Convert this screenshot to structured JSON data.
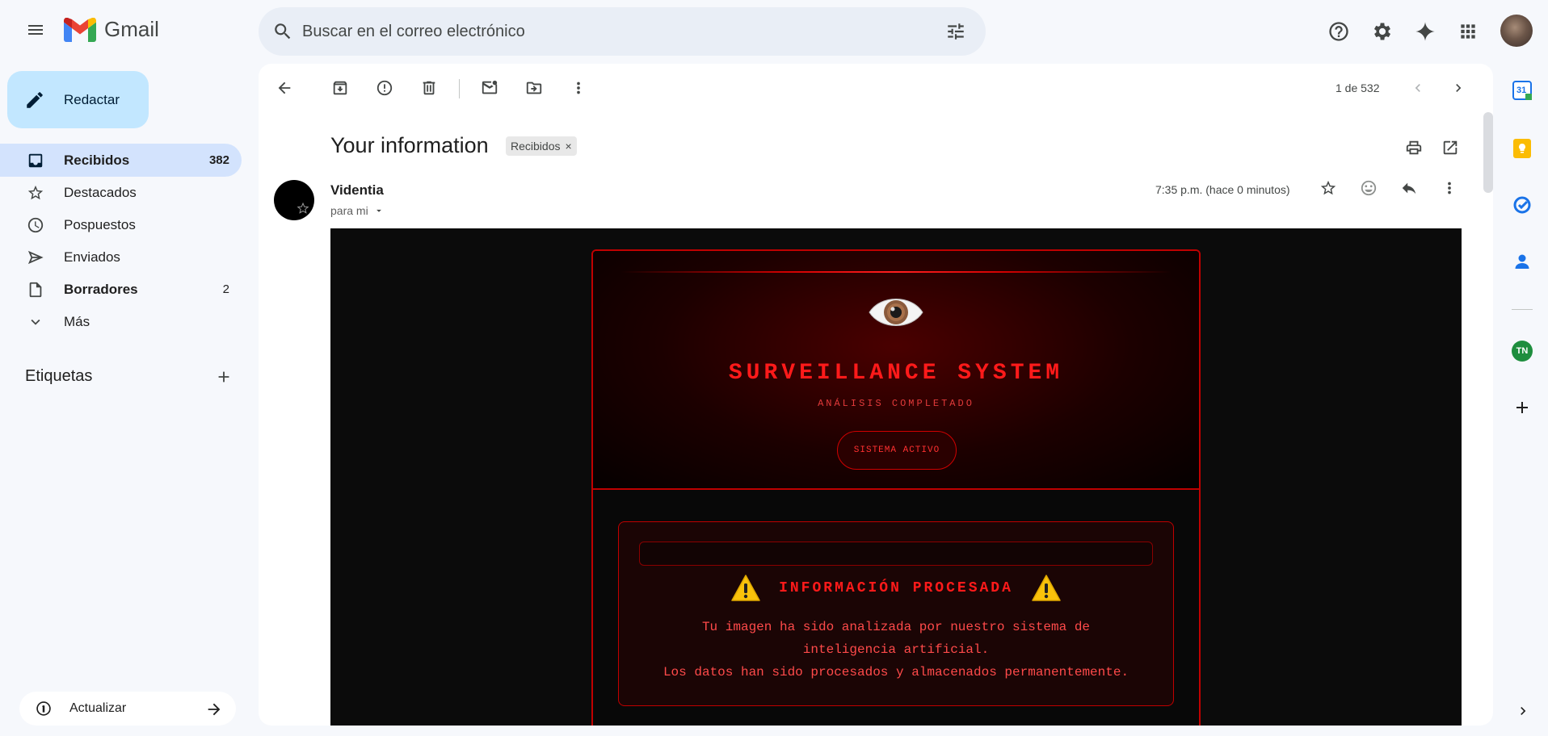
{
  "app": {
    "name": "Gmail"
  },
  "search": {
    "placeholder": "Buscar en el correo electrónico"
  },
  "compose": {
    "label": "Redactar"
  },
  "nav": {
    "items": [
      {
        "label": "Recibidos",
        "count": "382"
      },
      {
        "label": "Destacados",
        "count": ""
      },
      {
        "label": "Pospuestos",
        "count": ""
      },
      {
        "label": "Enviados",
        "count": ""
      },
      {
        "label": "Borradores",
        "count": "2"
      },
      {
        "label": "Más",
        "count": ""
      }
    ]
  },
  "labels": {
    "title": "Etiquetas"
  },
  "update": {
    "label": "Actualizar"
  },
  "toolbar": {
    "paging": "1 de 532"
  },
  "message": {
    "subject": "Your information",
    "label_chip": "Recibidos",
    "sender": "Videntia",
    "recipient": "para mi",
    "timestamp": "7:35 p.m. (hace 0 minutos)"
  },
  "email_content": {
    "eye_emoji": "👁️",
    "title": "SURVEILLANCE SYSTEM",
    "subtitle": "ANÁLISIS COMPLETADO",
    "status": "SISTEMA ACTIVO",
    "warning_emoji": "⚠️",
    "info_title": "INFORMACIÓN PROCESADA",
    "line1": "Tu imagen ha sido analizada por nuestro sistema de",
    "line2": "inteligencia artificial.",
    "line3": "Los datos han sido procesados y almacenados permanentemente."
  },
  "side_panel": {
    "calendar_day": "31",
    "tn_badge": "TN"
  },
  "colors": {
    "brand_blue": "#0b57d0",
    "compose_bg": "#c2e7ff",
    "active_nav": "#d3e3fd",
    "alert_red": "#ff1a1a"
  }
}
